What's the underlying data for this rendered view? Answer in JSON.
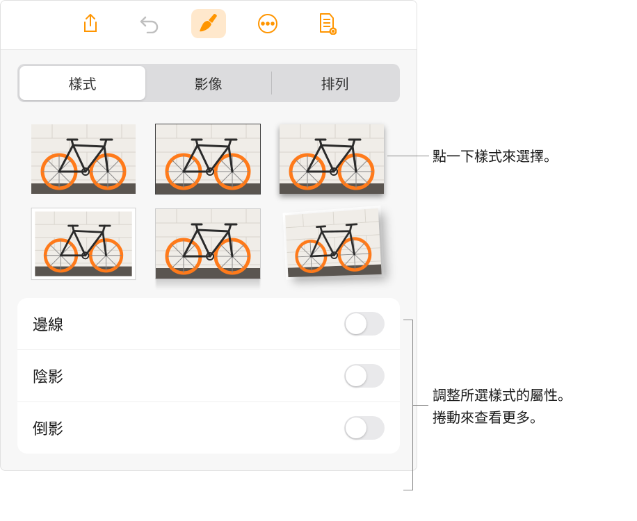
{
  "toolbar": {
    "icons": [
      "share",
      "undo",
      "format",
      "more",
      "document"
    ]
  },
  "tabs": {
    "items": [
      {
        "label": "樣式",
        "selected": true
      },
      {
        "label": "影像",
        "selected": false
      },
      {
        "label": "排列",
        "selected": false
      }
    ]
  },
  "options": {
    "border": {
      "label": "邊線",
      "on": false
    },
    "shadow": {
      "label": "陰影",
      "on": false
    },
    "reflection": {
      "label": "倒影",
      "on": false
    }
  },
  "callouts": {
    "style_tap": "點一下樣式來選擇。",
    "properties_line1": "調整所選樣式的屬性。",
    "properties_line2": "捲動來查看更多。"
  }
}
